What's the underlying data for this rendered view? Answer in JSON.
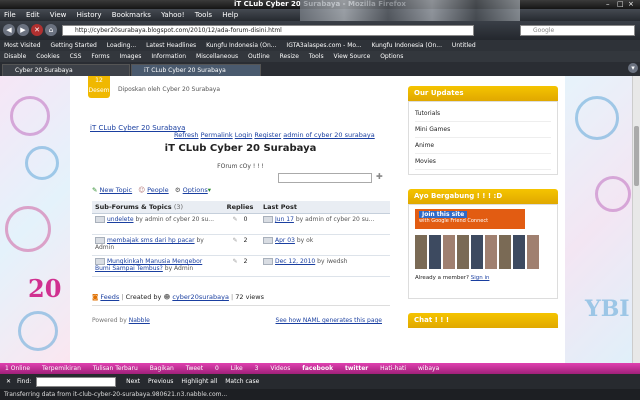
{
  "window": {
    "title": "iT CLub Cyber 20 Surabaya - Mozilla Firefox"
  },
  "menu": [
    "File",
    "Edit",
    "View",
    "History",
    "Bookmarks",
    "Yahoo!",
    "Tools",
    "Help"
  ],
  "nav": {
    "url": "http://cyber20surabaya.blogspot.com/2010/12/ada-forum-disini.html",
    "search_placeholder": "Google"
  },
  "bookmarks": [
    "Most Visited",
    "Getting Started",
    "Loading...",
    "Latest Headlines",
    "Kungfu Indonesia (On...",
    "IGTA3alaspes.com - Mo...",
    "Kungfu Indonesia (On...",
    "Untitled"
  ],
  "bookmarks2": [
    "Disable",
    "Cookies",
    "CSS",
    "Forms",
    "Images",
    "Information",
    "Miscellaneous",
    "Outline",
    "Resize",
    "Tools",
    "View Source",
    "Options"
  ],
  "tabs": [
    "Cyber 20 Surabaya",
    "iT CLub Cyber 20 Surabaya"
  ],
  "post": {
    "date_badge": "12 Desem",
    "posted_by": "Diposkan oleh Cyber 20 Surabaya",
    "breadcrumb": "iT CLub Cyber 20 Surabaya",
    "links": [
      "Refresh",
      "Permalink",
      "Login",
      "Register",
      "admin of cyber 20 surabaya"
    ],
    "forum_title": "iT CLub Cyber 20 Surabaya",
    "forum_subtitle": "FOrum cOy ! ! !",
    "actions": {
      "new_topic": "New Topic",
      "people": "People",
      "options": "Options"
    },
    "table_headers": {
      "topics": "Sub-Forums & Topics",
      "count": "(3)",
      "replies": "Replies",
      "last_post": "Last Post"
    },
    "topics": [
      {
        "title": "undelete",
        "by": "by admin of cyber 20 su...",
        "replies": "0",
        "date": "Jun 17",
        "last_by": "by admin of cyber 20 su..."
      },
      {
        "title": "membajak sms dari hp pacar",
        "by": "by Admin",
        "replies": "2",
        "date": "Apr 03",
        "last_by": "by ok"
      },
      {
        "title": "Mungkinkah Manusia Mengebor Bumi Sampai Tembus?",
        "by": "by Admin",
        "replies": "2",
        "date": "Dec 12, 2010",
        "last_by": "by iwedsh"
      }
    ],
    "footer": {
      "feeds": "Feeds",
      "created_by": "Created by",
      "creator": "cyber20surabaya",
      "views": "72 views"
    },
    "powered": "Powered by",
    "nabble": "Nabble",
    "naml": "See how NAML generates this page"
  },
  "sidebar": {
    "updates_title": "Our Updates",
    "updates": [
      "Tutorials",
      "Mini Games",
      "Anime",
      "Movies"
    ],
    "join_title": "Ayo Bergabung ! ! ! :D",
    "join_button": "Join this site",
    "join_sub": "with Google Friend Connect",
    "member_text": "Already a member?",
    "sign_in": "Sign in",
    "chat_title": "Chat ! ! !"
  },
  "statusbar": {
    "items": [
      "1 Online",
      "Terpemikiran",
      "Tulisan Terbaru",
      "Bagikan",
      "Tweet",
      "0",
      "Like",
      "3",
      "Videos",
      "facebook",
      "twitter",
      "Hati-hati",
      "wibaya"
    ]
  },
  "findbar": {
    "label": "Find:",
    "next": "Next",
    "previous": "Previous",
    "highlight": "Highlight all",
    "match": "Match case"
  },
  "status2": "Transferring data from it-club-cyber-20-surabaya.980621.n3.nabble.com...",
  "colors": {
    "widget": "#f0b800",
    "pinkbar": "#d6339f",
    "link": "#1a3fa0"
  }
}
